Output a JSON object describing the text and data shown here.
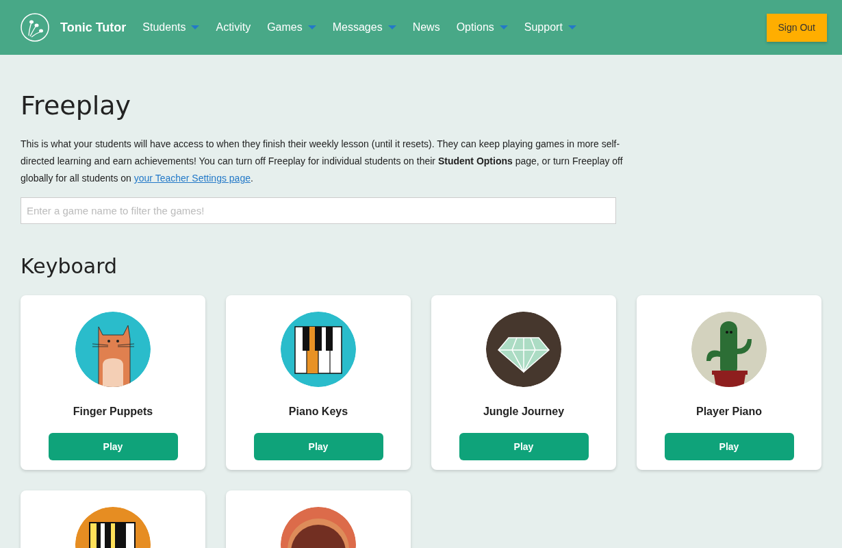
{
  "brand": {
    "name": "Tonic Tutor"
  },
  "nav": [
    {
      "label": "Students",
      "dropdown": true
    },
    {
      "label": "Activity",
      "dropdown": false
    },
    {
      "label": "Games",
      "dropdown": true
    },
    {
      "label": "Messages",
      "dropdown": true
    },
    {
      "label": "News",
      "dropdown": false
    },
    {
      "label": "Options",
      "dropdown": true
    },
    {
      "label": "Support",
      "dropdown": true
    }
  ],
  "sign_out": "Sign Out",
  "title": "Freeplay",
  "intro": {
    "text": "This is what your students will have access to when they finish their weekly lesson (until it resets). They can keep playing games in more self-directed learning and earn achievements! You can turn off Freeplay for individual students on their **Student Options** page, or turn Freeplay off globally for all students on ",
    "link": "your Teacher Settings page",
    "after": "."
  },
  "search": {
    "placeholder": "Enter a game name to filter the games!"
  },
  "section": "Keyboard",
  "games": [
    {
      "kind": "cat",
      "title": "Finger Puppets",
      "button": "Play"
    },
    {
      "kind": "piano",
      "title": "Piano Keys",
      "button": "Play"
    },
    {
      "kind": "diamond",
      "title": "Jungle Journey",
      "button": "Play"
    },
    {
      "kind": "cactus",
      "title": "Player Piano",
      "button": "Play"
    },
    {
      "kind": "keys"
    },
    {
      "kind": "bowl"
    }
  ]
}
